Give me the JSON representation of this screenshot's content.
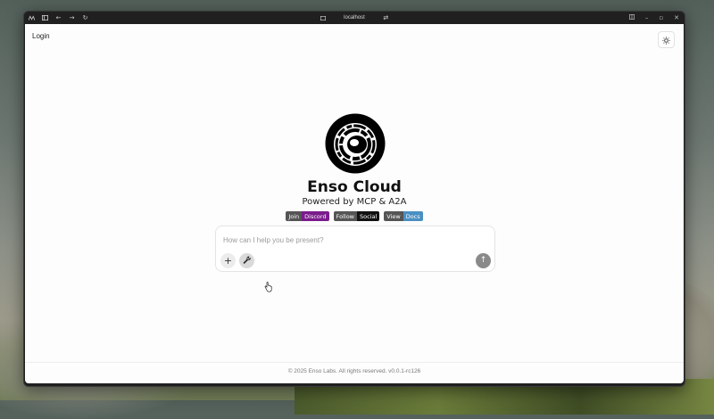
{
  "browser": {
    "url": "localhost"
  },
  "header": {
    "login_label": "Login"
  },
  "hero": {
    "title": "Enso Cloud",
    "subtitle": "Powered by MCP & A2A"
  },
  "badges": [
    {
      "left": "Join",
      "right": "Discord",
      "color": "#7a1c8c"
    },
    {
      "left": "Follow",
      "right": "Social",
      "color": "#111111"
    },
    {
      "left": "View",
      "right": "Docs",
      "color": "#4a8fc2"
    }
  ],
  "chat": {
    "placeholder": "How can I help you be present?"
  },
  "footer": {
    "text": "© 2025 Enso Labs. All rights reserved. v0.0.1-rc126"
  },
  "icons": {
    "sidebar_toggle": "sidebar-icon",
    "back": "arrow-left-icon",
    "forward": "arrow-right-icon",
    "reload": "reload-icon",
    "theme": "sun-icon",
    "add": "plus-icon",
    "tools": "wrench-icon",
    "send": "arrow-up-icon"
  }
}
